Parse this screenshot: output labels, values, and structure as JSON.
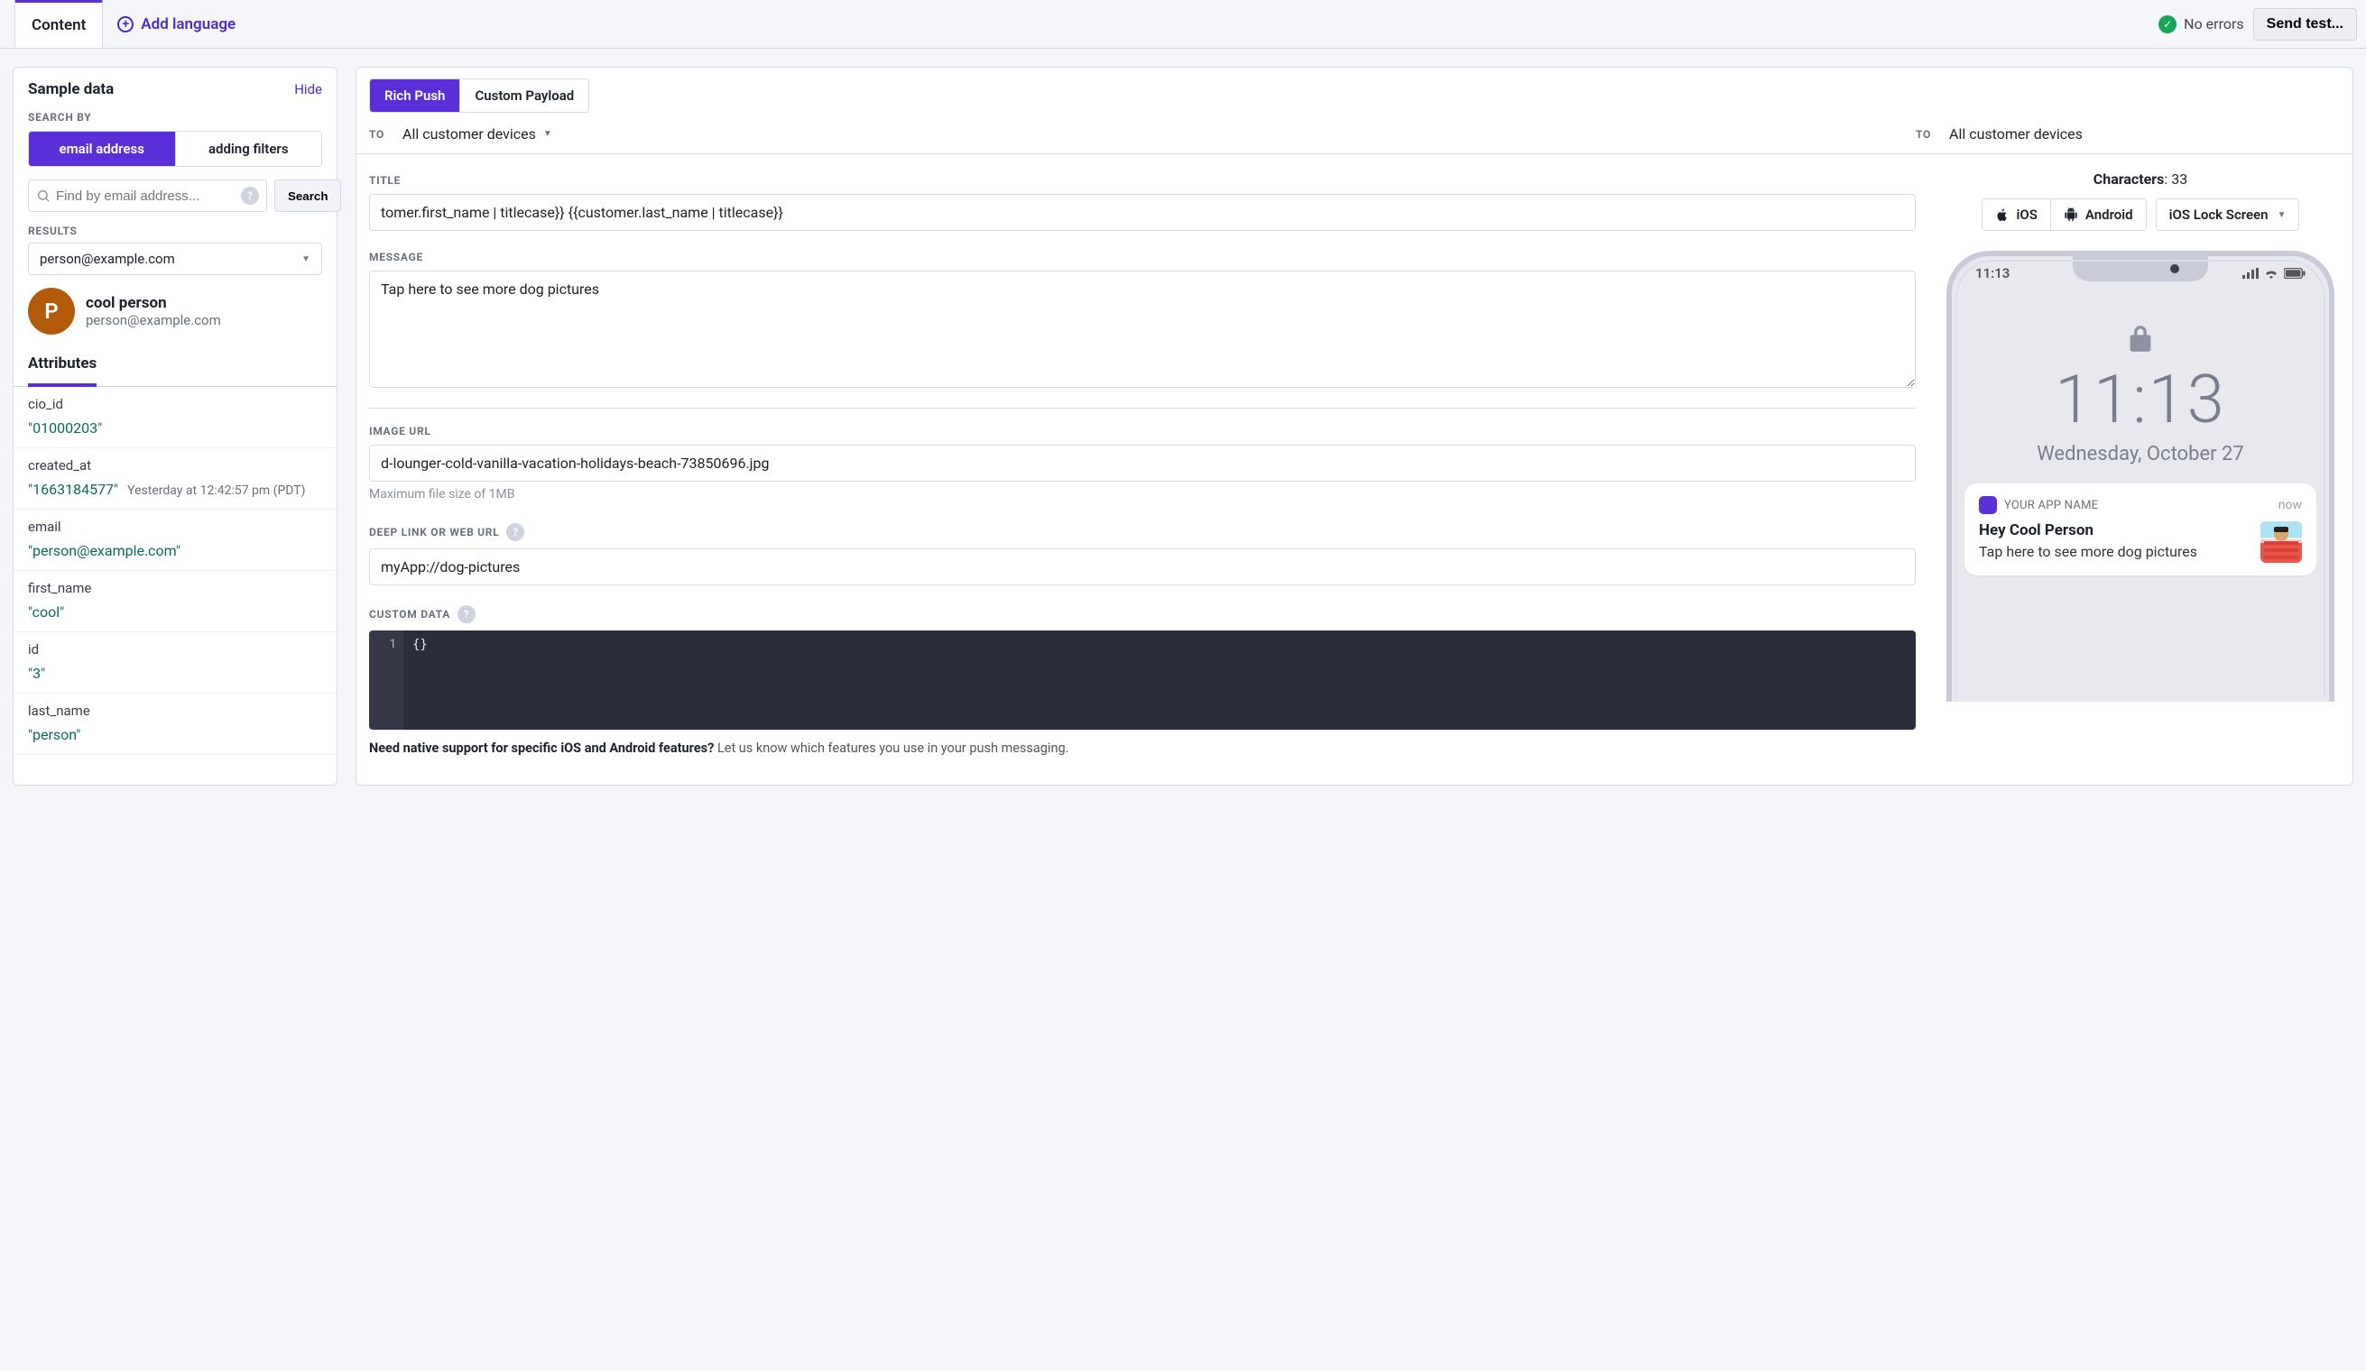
{
  "top": {
    "content_tab": "Content",
    "add_language": "Add language",
    "no_errors": "No errors",
    "send_test": "Send test..."
  },
  "left": {
    "title": "Sample data",
    "hide": "Hide",
    "search_by_label": "SEARCH BY",
    "search_by": {
      "email": "email address",
      "filters": "adding filters"
    },
    "search_placeholder": "Find by email address...",
    "search_btn": "Search",
    "results_label": "RESULTS",
    "results_value": "person@example.com",
    "person": {
      "initial": "P",
      "name": "cool person",
      "email": "person@example.com"
    },
    "attributes_tab": "Attributes",
    "attributes": [
      {
        "key": "cio_id",
        "value": "\"01000203\""
      },
      {
        "key": "created_at",
        "value": "\"1663184577\"",
        "meta": "Yesterday at 12:42:57 pm (PDT)"
      },
      {
        "key": "email",
        "value": "\"person@example.com\""
      },
      {
        "key": "first_name",
        "value": "\"cool\""
      },
      {
        "key": "id",
        "value": "\"3\""
      },
      {
        "key": "last_name",
        "value": "\"person\""
      }
    ]
  },
  "form": {
    "tabs": {
      "rich": "Rich Push",
      "custom": "Custom Payload"
    },
    "to_label": "TO",
    "to_value": "All customer devices",
    "title_label": "TITLE",
    "title_value": "tomer.first_name | titlecase}} {{customer.last_name | titlecase}}",
    "message_label": "MESSAGE",
    "message_value": "Tap here to see more dog pictures",
    "image_label": "IMAGE URL",
    "image_value": "d-lounger-cold-vanilla-vacation-holidays-beach-73850696.jpg",
    "image_help": "Maximum file size of 1MB",
    "link_label": "DEEP LINK OR WEB URL",
    "link_value": "myApp://dog-pictures",
    "custom_label": "CUSTOM DATA",
    "custom_code": "{}",
    "native_hint_bold": "Need native support for specific iOS and Android features?",
    "native_hint_rest": " Let us know which features you use in your push messaging."
  },
  "preview": {
    "to_label": "TO",
    "to_value": "All customer devices",
    "characters_label": "Characters",
    "characters_value": "33",
    "ios": "iOS",
    "android": "Android",
    "lock_screen": "iOS Lock Screen",
    "statusbar_time": "11:13",
    "big_time": "11:13",
    "big_date": "Wednesday, October 27",
    "app_name": "YOUR APP NAME",
    "when": "now",
    "notif_title": "Hey Cool Person",
    "notif_msg": "Tap here to see more dog pictures"
  }
}
